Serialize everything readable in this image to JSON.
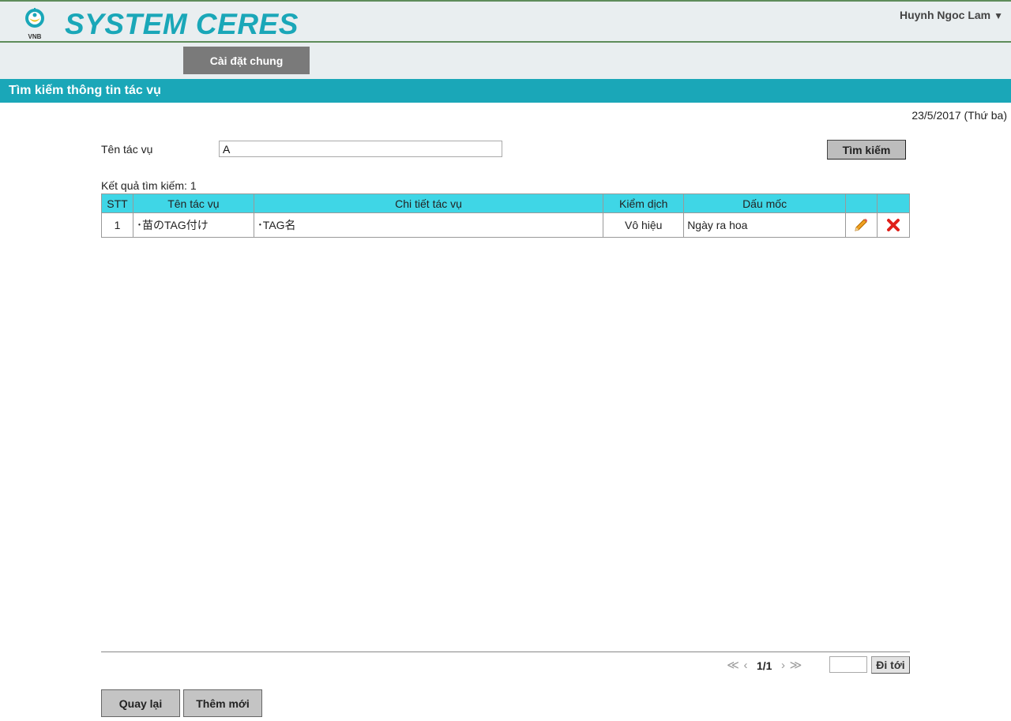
{
  "header": {
    "logo_text": "VNB",
    "app_title": "SYSTEM CERES",
    "user_name": "Huynh Ngoc Lam",
    "user_caret": "▼"
  },
  "nav": {
    "tabs": [
      {
        "label": "Cài đặt chung"
      }
    ]
  },
  "section": {
    "title": "Tìm kiếm thông tin tác vụ"
  },
  "date": "23/5/2017 (Thứ ba)",
  "search": {
    "field_label": "Tên tác vụ",
    "field_value": "A",
    "button_label": "Tìm kiếm"
  },
  "results": {
    "count_label": "Kết quả tìm kiếm: 1",
    "columns": [
      "STT",
      "Tên tác vụ",
      "Chi tiết tác vụ",
      "Kiểm dịch",
      "Dấu mốc",
      "",
      ""
    ],
    "rows": [
      {
        "stt": "1",
        "name": "･苗のTAG付け",
        "detail": "･TAG名",
        "quarantine": "Vô hiệu",
        "milestone": "Ngày ra hoa"
      }
    ],
    "row_icons": {
      "edit": "pencil-icon",
      "delete": "delete-x-icon"
    }
  },
  "pagination": {
    "first": "≪",
    "prev": "‹",
    "page_info": "1/1",
    "next": "›",
    "last": "≫",
    "goto_value": "",
    "goto_label": "Đi tới"
  },
  "footer": {
    "back_label": "Quay lại",
    "add_label": "Thêm mới"
  },
  "colors": {
    "accent": "#1aa7b8",
    "table_header": "#3fd6e6",
    "border_green": "#5e8c5a",
    "delete_red": "#e0201a",
    "edit_orange": "#f0a020"
  }
}
